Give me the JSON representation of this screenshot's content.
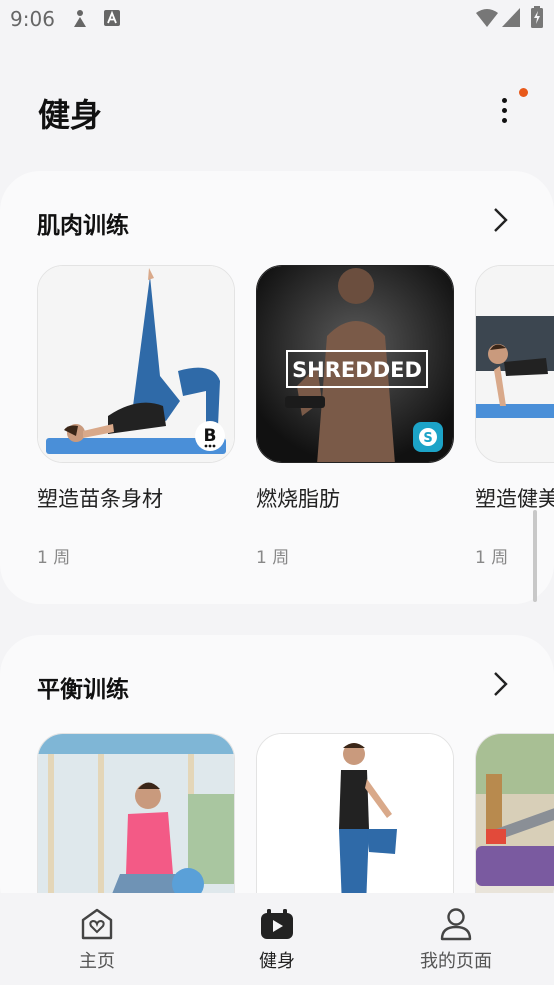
{
  "status_bar": {
    "time": "9:06"
  },
  "header": {
    "title": "健身"
  },
  "sections": [
    {
      "title": "肌肉训练",
      "items": [
        {
          "title": "塑造苗条身材",
          "duration": "1 周",
          "badge_letter": "B"
        },
        {
          "title": "燃烧脂肪",
          "duration": "1 周",
          "image_text": "SHREDDED",
          "badge_letter": "S"
        },
        {
          "title": "塑造健美",
          "duration": "1 周"
        }
      ]
    },
    {
      "title": "平衡训练",
      "items": [
        {
          "title": ""
        },
        {
          "title": ""
        },
        {
          "title": ""
        }
      ]
    }
  ],
  "bottom_nav": [
    {
      "label": "主页",
      "icon": "home-heart-icon"
    },
    {
      "label": "健身",
      "icon": "fitness-play-icon"
    },
    {
      "label": "我的页面",
      "icon": "person-icon"
    }
  ],
  "colors": {
    "notification_dot": "#e8591a",
    "badge_teal": "#1ca3c7",
    "mat_blue": "#4a8fd8"
  }
}
